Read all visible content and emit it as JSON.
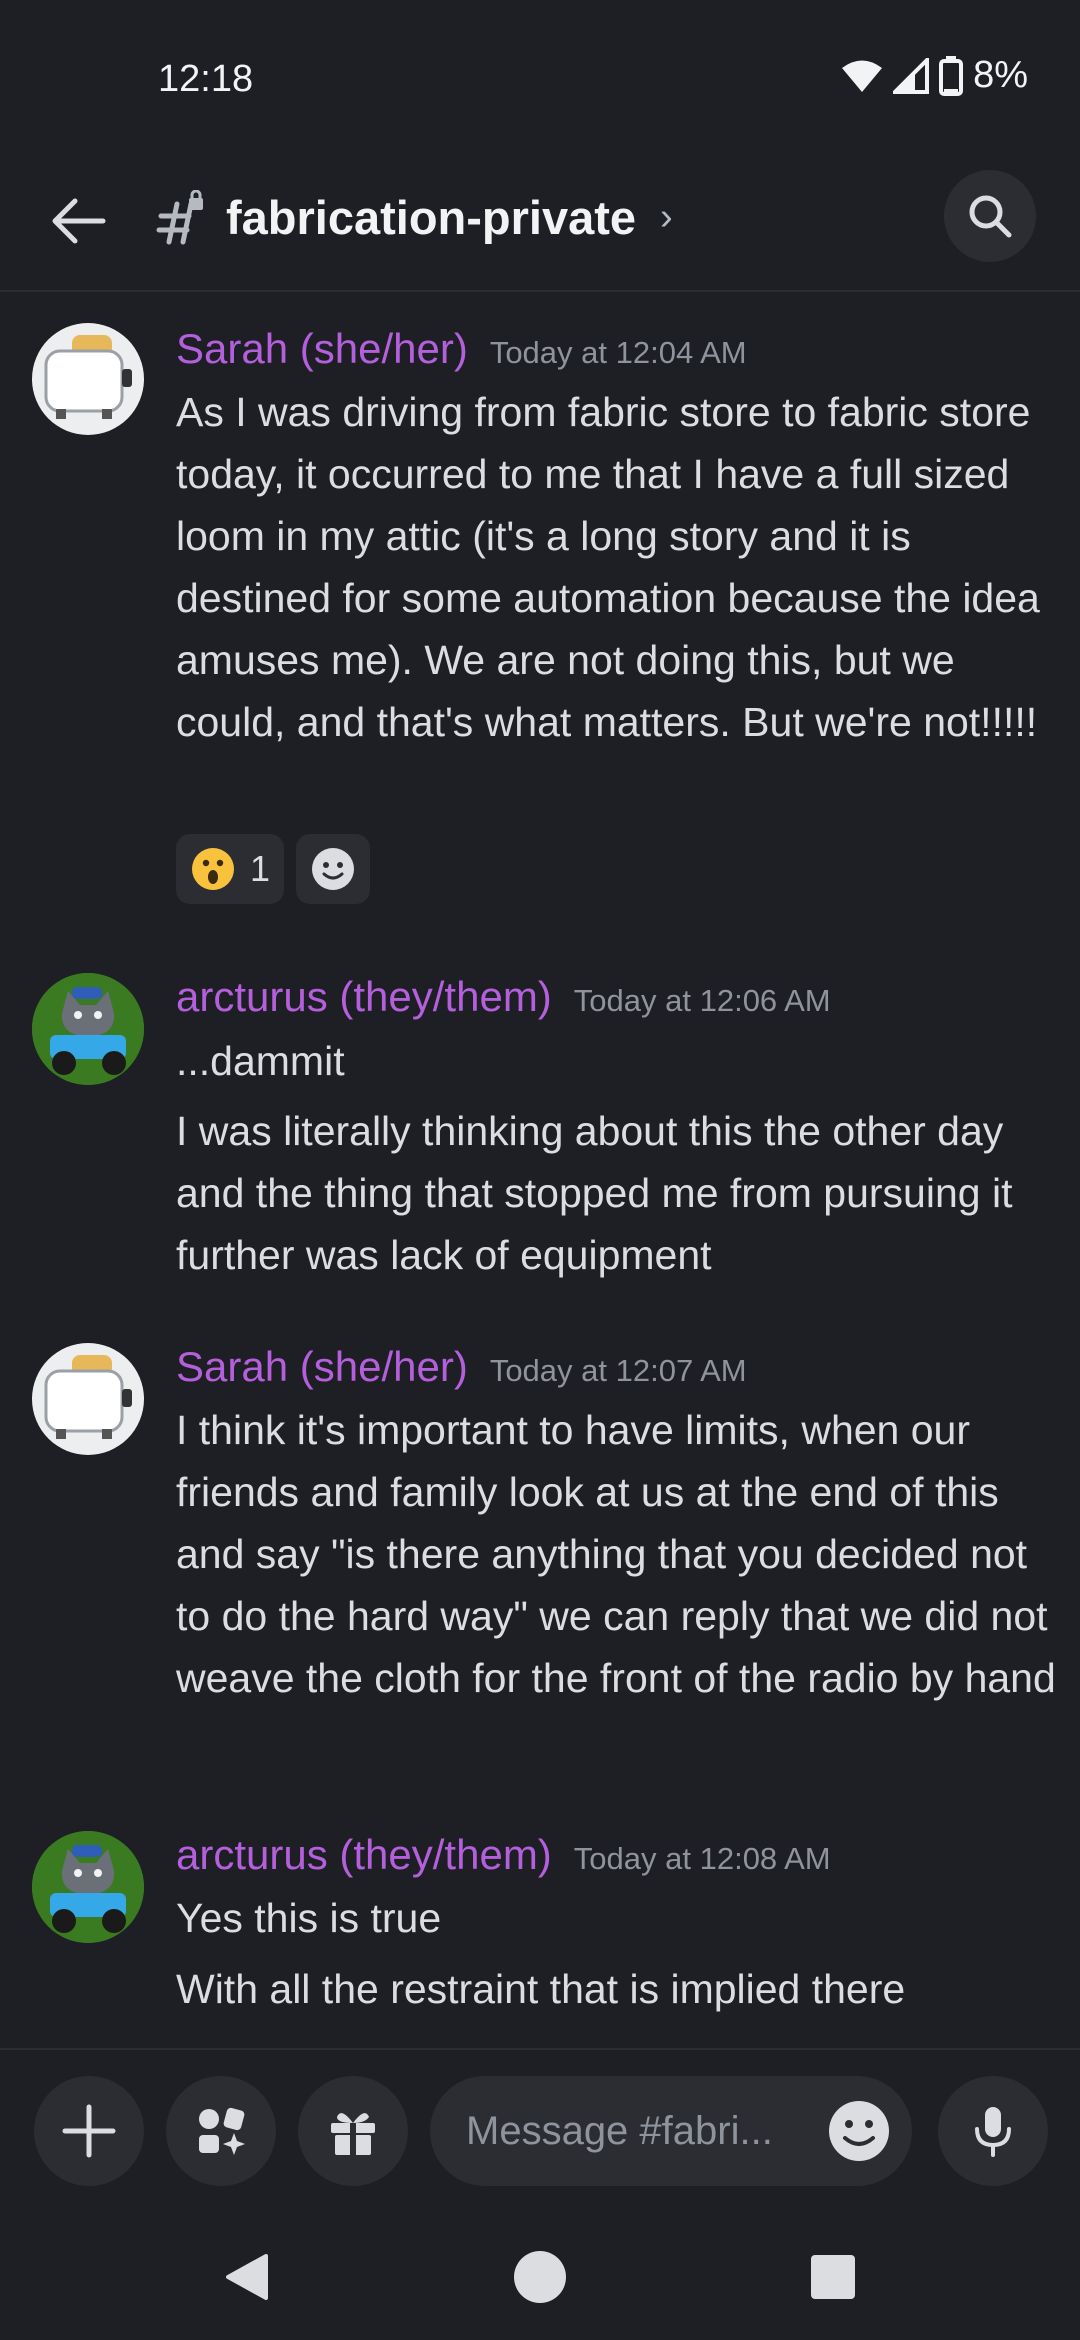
{
  "status_bar": {
    "time": "12:18",
    "battery": "8%"
  },
  "channel": {
    "name": "fabrication-private"
  },
  "messages": [
    {
      "author": "Sarah (she/her)",
      "timestamp": "Today at 12:04 AM",
      "lines": [
        "As I was driving from fabric store to fabric store today, it occurred to me that I have a full sized loom in my attic (it's a long story and it is destined for some automation because the idea amuses me). We are not doing this, but we could, and that's what matters. But we're not!!!!!"
      ],
      "reactions": [
        {
          "emoji": "astonished-face",
          "count": "1"
        }
      ]
    },
    {
      "author": "arcturus (they/them)",
      "timestamp": "Today at 12:06 AM",
      "lines": [
        "...dammit",
        "I was literally thinking about this the other day and the thing that stopped me from pursuing it further was lack of equipment"
      ]
    },
    {
      "author": "Sarah (she/her)",
      "timestamp": "Today at 12:07 AM",
      "lines": [
        "I think it's important to have limits, when our friends and family look at us at the end of this and say \"is there anything that you decided not to do the hard way\" we can reply that we did not weave the cloth for the front of the radio by hand"
      ]
    },
    {
      "author": "arcturus (they/them)",
      "timestamp": "Today at 12:08 AM",
      "lines": [
        "Yes this is true",
        "With all the restraint that is implied there"
      ]
    }
  ],
  "composer": {
    "placeholder": "Message #fabri..."
  },
  "colors": {
    "background": "#1e1f24",
    "author": "#b45fdc",
    "surface": "#2b2d33",
    "text": "#dcdde1"
  }
}
